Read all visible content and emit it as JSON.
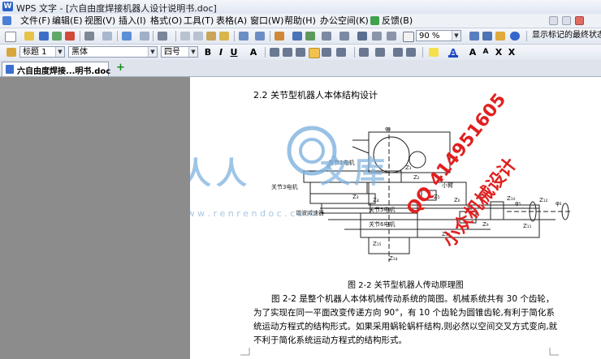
{
  "window": {
    "logo": "W",
    "title": "WPS 文字 - [六自由度焊接机器人设计说明书.doc]"
  },
  "menu": [
    "文件(F)",
    "编辑(E)",
    "视图(V)",
    "插入(I)",
    "格式(O)",
    "工具(T)",
    "表格(A)",
    "窗口(W)",
    "帮助(H)",
    "办公空间(K)",
    "反馈(B)"
  ],
  "toolbar1": {
    "zoom": "90 %",
    "markup_display": "显示标记的最终状态"
  },
  "toolbar2": {
    "style": "标题 1",
    "font": "黑体",
    "size": "四号",
    "bold": "B",
    "italic": "I",
    "underline": "U",
    "font_color_label": "A",
    "grow_font": "A",
    "shrink_font": "A",
    "superscript": "X",
    "subscript": "X"
  },
  "tabs": {
    "doc_tab": "六自由度焊接...明书.doc",
    "add": "+"
  },
  "document": {
    "heading": "2.2  关节型机器人本体结构设计",
    "caption": "图 2-2   关节型机器人传动原理图",
    "paragraph": "图 2-2 是整个机器人本体机械传动系统的简图。机械系统共有 30 个齿轮，为了实现在同一平面改变传递方向 90°，有 10 个齿轮为圆锥齿轮,有利于简化系统运动方程式的结构形式。如果采用蜗轮蜗杆结构,则必然以空间交叉方式变向,就不利于简化系统运动方程式的结构形式。"
  },
  "figure_labels": {
    "motor_j2": "关节2电机",
    "motor_j3": "关节3电机",
    "motor_j5": "关节5电机",
    "motor_j6": "关节6电机",
    "harmonic": "谐波减速器",
    "arm": "小臂",
    "z1": "Z₁",
    "z2": "Z₂",
    "z3": "Z₃",
    "z4": "Z₄",
    "z5": "Z₅",
    "z6": "Z₆",
    "z7": "Z₇",
    "z8": "Z₈",
    "z9": "Z₉",
    "z10": "Z₁₀",
    "z11": "Z₁₁",
    "z12": "Z₁₂",
    "z13": "Z₁₃",
    "z14": "Z₁₄",
    "z15": "Z₁₅",
    "phi1": "φ₁",
    "phi5": "φ₅",
    "phi6": "φ₆"
  },
  "watermarks": {
    "logo_text": "人人",
    "logo_text2": "文库",
    "url": "w w w . r e n r e n d o c . c o m",
    "qq": "QQ 414951605",
    "brand": "小众机械设计"
  }
}
